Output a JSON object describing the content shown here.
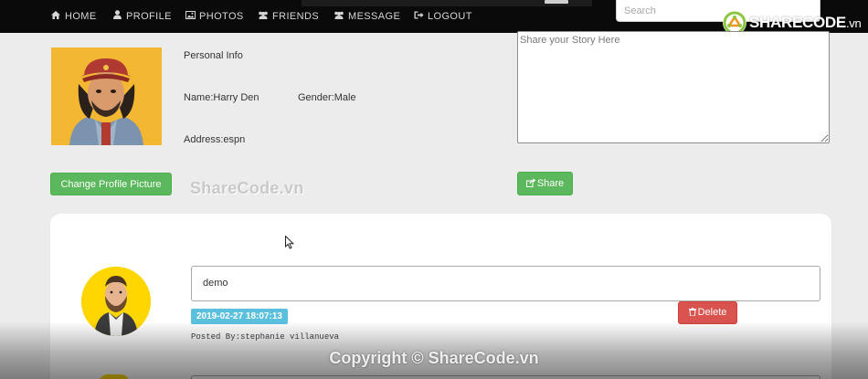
{
  "nav": {
    "items": [
      {
        "label": "HOME",
        "icon": "home-icon",
        "glyph": "⌂"
      },
      {
        "label": "PROFILE",
        "icon": "user-icon",
        "glyph": "👤"
      },
      {
        "label": "PHOTOS",
        "icon": "picture-icon",
        "glyph": "▣"
      },
      {
        "label": "FRIENDS",
        "icon": "users-icon",
        "glyph": "👥"
      },
      {
        "label": "MESSAGE",
        "icon": "comments-icon",
        "glyph": "👥"
      },
      {
        "label": "LOGOUT",
        "icon": "sign-out-icon",
        "glyph": "⇥"
      }
    ],
    "search_placeholder": "Search"
  },
  "brand": {
    "name": "SHARECODE",
    "suffix": ".vn"
  },
  "profile": {
    "heading": "Personal Info",
    "name": "Name:Harry Den",
    "gender": "Gender:Male",
    "address": "Address:espn",
    "change_picture_label": "Change Profile Picture"
  },
  "story": {
    "placeholder": "Share your Story Here",
    "share_label": "Share",
    "share_icon": "share-icon"
  },
  "posts": [
    {
      "text": "demo",
      "timestamp": "2019-02-27 18:07:13",
      "posted_by": "Posted By:stephanie villanueva",
      "delete_label": "Delete",
      "delete_icon": "trash-icon"
    }
  ],
  "watermarks": {
    "middle": "ShareCode.vn",
    "copyright": "Copyright © ShareCode.vn"
  },
  "colors": {
    "navbar": "#0a0a0a",
    "success": "#5cb85c",
    "info": "#5bc0de",
    "danger": "#d9534f",
    "avatar_bg": "#ffd600",
    "profile_bg": "#f3b731"
  }
}
